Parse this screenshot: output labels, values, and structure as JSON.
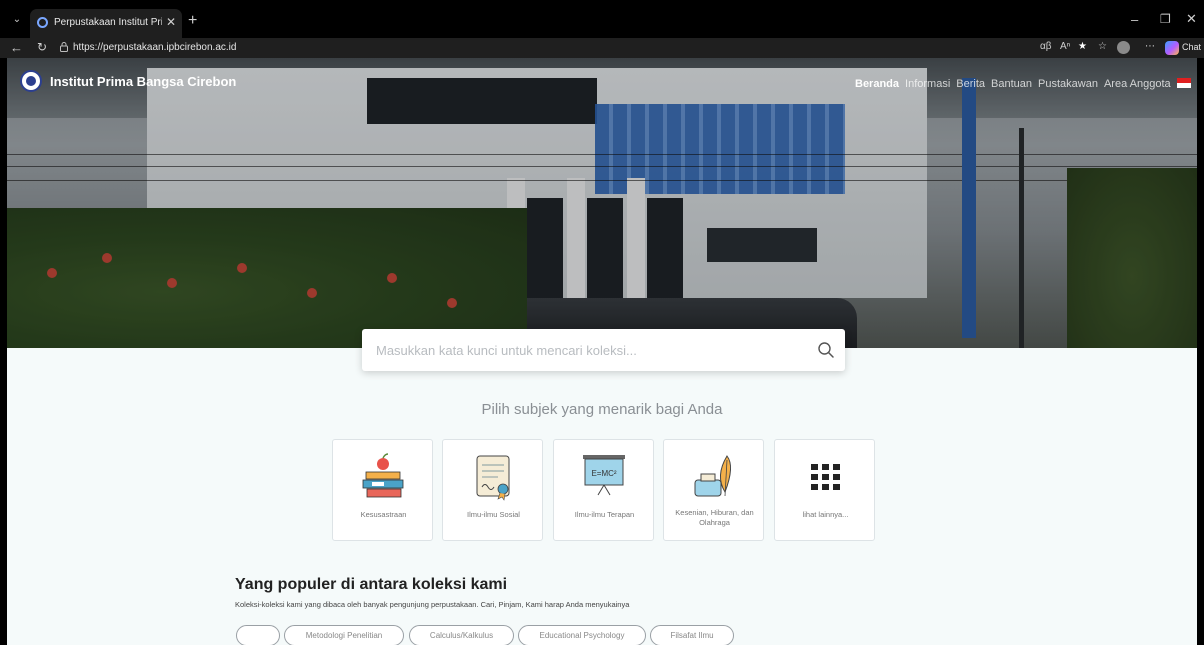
{
  "browser": {
    "tab_title": "Perpustakaan Institut Prima Bangsa",
    "url": "https://perpustakaan.ipbcirebon.ac.id",
    "chat_label": "Chat",
    "icons": [
      "tab-dropdown-icon",
      "close-icon",
      "new-tab-icon",
      "back-icon",
      "reload-icon",
      "lock-icon",
      "translate-icon",
      "read-aloud-icon",
      "favorite-star-icon",
      "favorites-icon",
      "profile-icon",
      "more-icon",
      "copilot-icon"
    ]
  },
  "site": {
    "brand_name": "Institut Prima Bangsa Cirebon",
    "nav": [
      {
        "label": "Beranda",
        "active": true
      },
      {
        "label": "Informasi"
      },
      {
        "label": "Berita"
      },
      {
        "label": "Bantuan"
      },
      {
        "label": "Pustakawan"
      },
      {
        "label": "Area Anggota"
      }
    ],
    "flag_colors": [
      "#e02020",
      "#ffffff"
    ]
  },
  "search": {
    "placeholder": "Masukkan kata kunci untuk mencari koleksi..."
  },
  "subjects": {
    "heading": "Pilih subjek yang menarik bagi Anda",
    "items": [
      {
        "label": "Kesusastraan",
        "icon": "books-apple-icon"
      },
      {
        "label": "Ilmu-ilmu Sosial",
        "icon": "certificate-icon"
      },
      {
        "label": "Ilmu-ilmu Terapan",
        "icon": "formula-board-icon",
        "board_text": "E=MC²"
      },
      {
        "label": "Kesenian, Hiburan, dan Olahraga",
        "icon": "ink-quill-icon"
      },
      {
        "label": "lihat lainnya...",
        "icon": "grid-icon"
      }
    ]
  },
  "popular": {
    "title": "Yang populer di antara koleksi kami",
    "description": "Koleksi-koleksi kami yang dibaca oleh banyak pengunjung perpustakaan. Cari, Pinjam, Kami harap Anda menyukainya",
    "chips": [
      "",
      "Metodologi Penelitian",
      "Calculus/Kalkulus",
      "Educational Psychology",
      "Filsafat Ilmu"
    ]
  }
}
